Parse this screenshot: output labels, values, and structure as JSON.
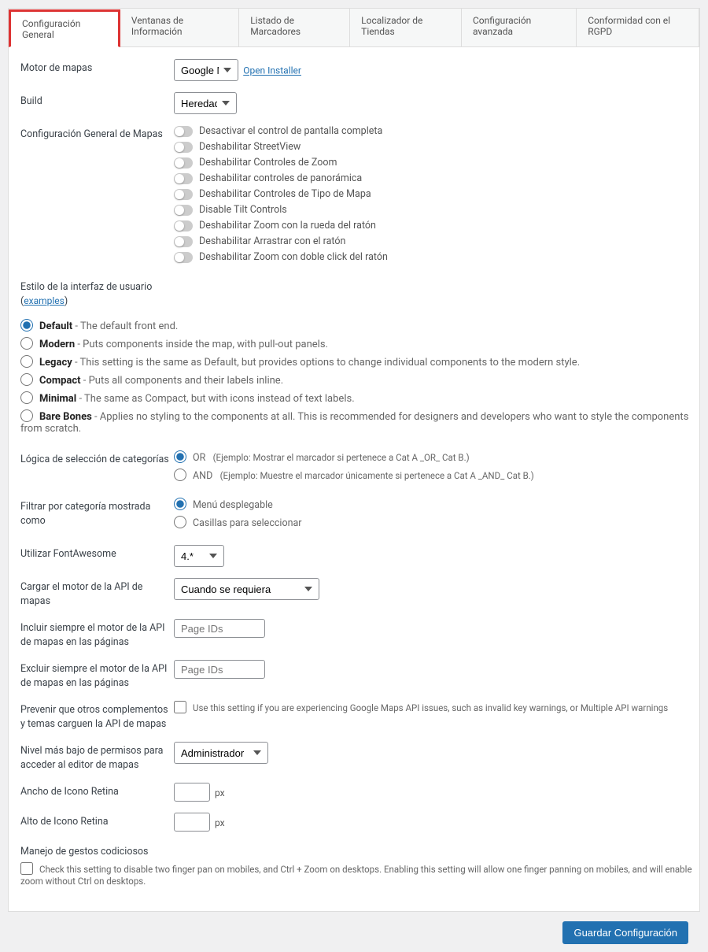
{
  "tabs": [
    "Configuración General",
    "Ventanas de Información",
    "Listado de Marcadores",
    "Localizador de Tiendas",
    "Configuración avanzada",
    "Conformidad con el RGPD"
  ],
  "labels": {
    "mapEngine": "Motor de mapas",
    "build": "Build",
    "generalMapConfig": "Configuración General de Mapas",
    "uiStyle": "Estilo de la interfaz de usuario",
    "examples": "examples",
    "categoryLogic": "Lógica de selección de categorías",
    "filterDisplay": "Filtrar por categoría mostrada como",
    "fontAwesome": "Utilizar FontAwesome",
    "apiLoad": "Cargar el motor de la API de mapas",
    "alwaysInclude": "Incluir siempre el motor de la API de mapas en las páginas",
    "alwaysExclude": "Excluir siempre el motor de la API de mapas en las páginas",
    "preventOthers": "Prevenir que otros complementos y temas carguen la API de mapas",
    "permissionLevel": "Nivel más bajo de permisos para acceder al editor de mapas",
    "retinaWidth": "Ancho de Icono Retina",
    "retinaHeight": "Alto de Icono Retina",
    "greedyGestures": "Manejo de gestos codiciosos"
  },
  "selects": {
    "mapEngine": "Google Maps",
    "build": "Heredado",
    "fontAwesome": "4.*",
    "apiLoad": "Cuando se requiera",
    "permission": "Administrador"
  },
  "openInstaller": "Open Installer",
  "toggles": [
    "Desactivar el control de pantalla completa",
    "Deshabilitar StreetView",
    "Deshabilitar Controles de Zoom",
    "Deshabilitar controles de panorámica",
    "Deshabilitar Controles de Tipo de Mapa",
    "Disable Tilt Controls",
    "Deshabilitar Zoom con la rueda del ratón",
    "Deshabilitar Arrastrar con el ratón",
    "Deshabilitar Zoom con doble click del ratón"
  ],
  "uiStyles": [
    {
      "name": "Default",
      "desc": " - The default front end."
    },
    {
      "name": "Modern",
      "desc": " - Puts components inside the map, with pull-out panels."
    },
    {
      "name": "Legacy",
      "desc": " - This setting is the same as Default, but provides options to change individual components to the modern style."
    },
    {
      "name": "Compact",
      "desc": " - Puts all components and their labels inline."
    },
    {
      "name": "Minimal",
      "desc": " - The same as Compact, but with icons instead of text labels."
    },
    {
      "name": "Bare Bones",
      "desc": " - Applies no styling to the components at all. This is recommended for designers and developers who want to style the components from scratch."
    }
  ],
  "logic": {
    "or": "OR",
    "orDesc": "(Ejemplo: Mostrar el marcador si pertenece a Cat A _OR_ Cat B.)",
    "and": "AND",
    "andDesc": "(Ejemplo: Muestre el marcador únicamente si pertenece a Cat A _AND_ Cat B.)"
  },
  "filter": {
    "dropdown": "Menú desplegable",
    "checkbox": "Casillas para seleccionar"
  },
  "placeholders": {
    "pageIds": "Page IDs"
  },
  "hints": {
    "prevent": "Use this setting if you are experiencing Google Maps API issues, such as invalid key warnings, or Multiple API warnings",
    "greedy": "Check this setting to disable two finger pan on mobiles, and Ctrl + Zoom on desktops. Enabling this setting will allow one finger panning on mobiles, and will enable zoom without Ctrl on desktops."
  },
  "px": "px",
  "saveButton": "Guardar Configuración"
}
